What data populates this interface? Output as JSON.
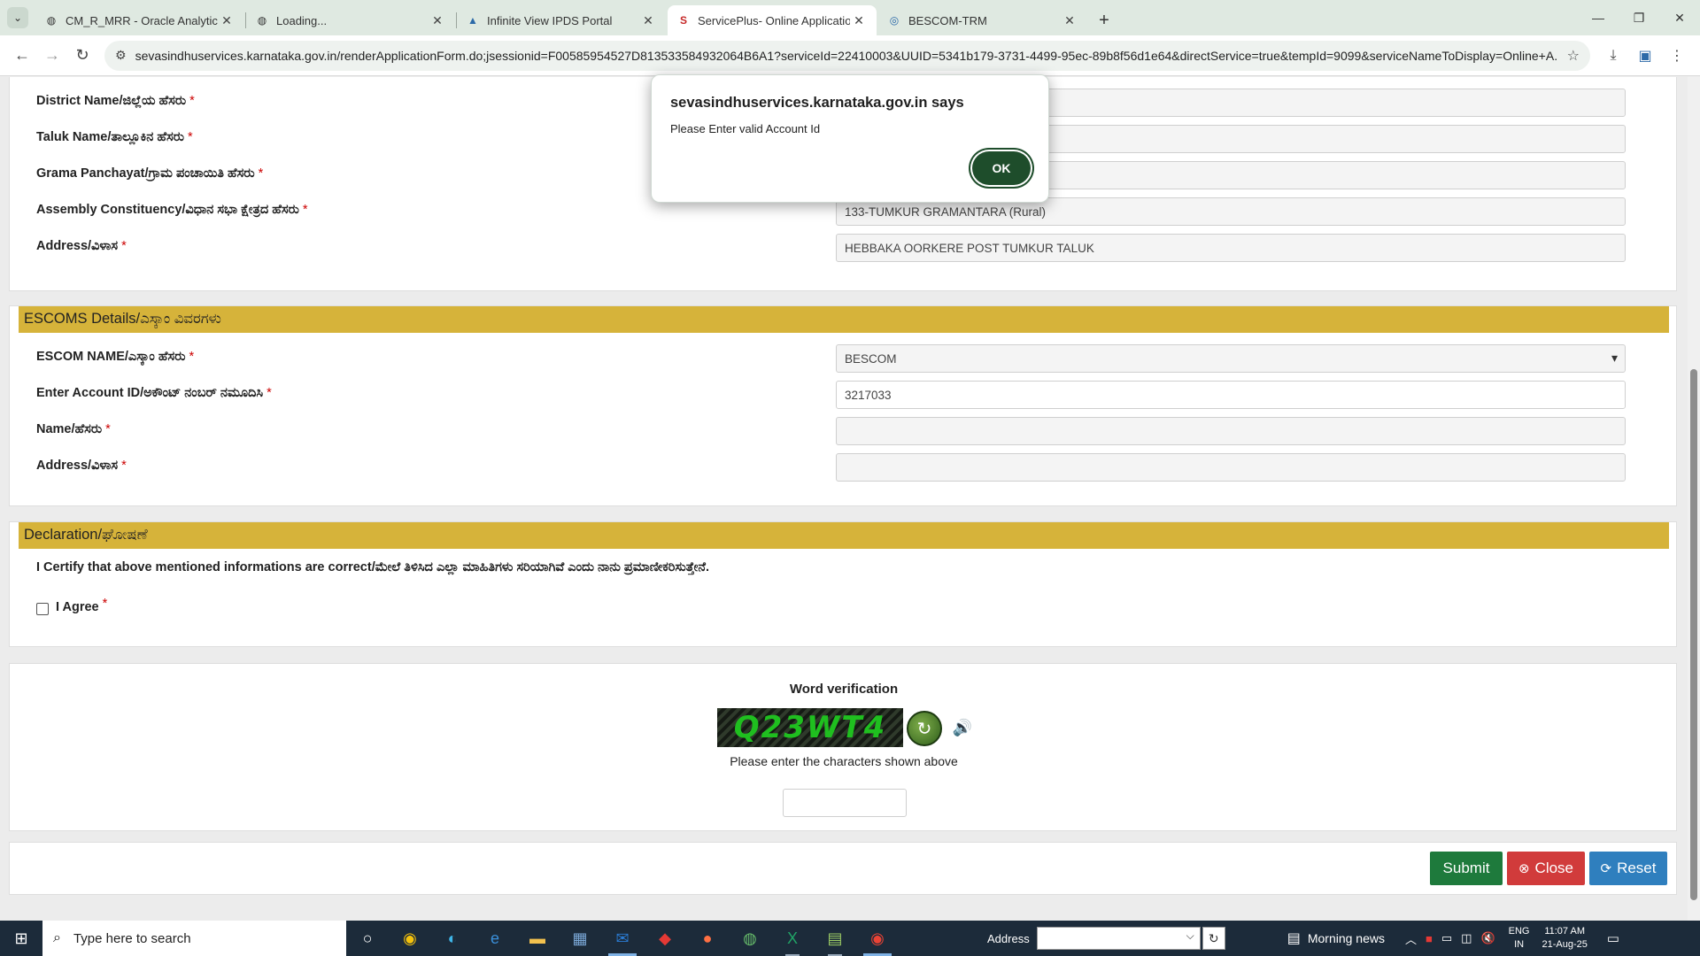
{
  "browser": {
    "tabs": [
      {
        "title": "CM_R_MRR - Oracle Analytics P",
        "icon": "globe-icon"
      },
      {
        "title": "Loading...",
        "icon": "globe-icon"
      },
      {
        "title": "Infinite View IPDS Portal",
        "icon": "portal-icon"
      },
      {
        "title": "ServicePlus- Online Application",
        "icon": "serviceplus-icon",
        "active": true
      },
      {
        "title": "BESCOM-TRM",
        "icon": "bescom-icon"
      }
    ],
    "url": "sevasindhuservices.karnataka.gov.in/renderApplicationForm.do;jsessionid=F00585954527D813533584932064B6A1?serviceId=22410003&UUID=5341b179-3731-4499-95ec-89b8f56d1e64&directService=true&tempId=9099&serviceNameToDisplay=Online+A..."
  },
  "address_section": {
    "rows": [
      {
        "label": "District Name/ಜಿಲ್ಲೆಯ ಹೆಸರು",
        "value": ""
      },
      {
        "label": "Taluk Name/ತಾಲ್ಲೂಕಿನ ಹೆಸರು",
        "value": ""
      },
      {
        "label": "Grama Panchayat/ಗ್ರಾಮ ಪಂಚಾಯಿತಿ ಹೆಸರು",
        "value": ""
      },
      {
        "label": "Assembly Constituency/ವಿಧಾನ ಸಭಾ ಕ್ಷೇತ್ರದ ಹೆಸರು",
        "value": "133-TUMKUR GRAMANTARA (Rural)"
      },
      {
        "label": "Address/ವಿಳಾಸ",
        "value": "HEBBAKA OORKERE POST TUMKUR TALUK"
      }
    ]
  },
  "escom_section": {
    "heading": "ESCOMS Details/ಎಸ್ಕಾಂ ವಿವರಗಳು",
    "rows": [
      {
        "label": "ESCOM NAME/ಎಸ್ಕಾಂ ಹೆಸರು",
        "value": "BESCOM"
      },
      {
        "label": "Enter Account ID/ಅಕೌಂಟ್ ನಂಬರ್ ನಮೂದಿಸಿ",
        "value": "3217033"
      },
      {
        "label": "Name/ಹೆಸರು",
        "value": ""
      },
      {
        "label": "Address/ವಿಳಾಸ",
        "value": ""
      }
    ]
  },
  "declaration": {
    "heading": "Declaration/ಘೋಷಣೆ",
    "text": "I Certify that above mentioned informations are correct/ಮೇಲೆ ತಿಳಿಸಿದ ಎಲ್ಲಾ ಮಾಹಿತಿಗಳು ಸರಿಯಾಗಿವೆ ಎಂದು ನಾನು ಪ್ರಮಾಣೀಕರಿಸುತ್ತೇನೆ.",
    "agree_label": "I Agree"
  },
  "captcha": {
    "title": "Word verification",
    "code": "Q23WT4",
    "hint": "Please enter the characters shown above"
  },
  "actions": {
    "submit": "Submit",
    "close": "Close",
    "reset": "Reset"
  },
  "required_mark": "*",
  "dialog": {
    "title": "sevasindhuservices.karnataka.gov.in says",
    "message": "Please Enter valid Account Id",
    "ok": "OK"
  },
  "taskbar": {
    "search_placeholder": "Type here to search",
    "address_label": "Address",
    "news": "Morning news",
    "lang_top": "ENG",
    "lang_bottom": "IN",
    "time": "11:07 AM",
    "date": "21-Aug-25"
  }
}
